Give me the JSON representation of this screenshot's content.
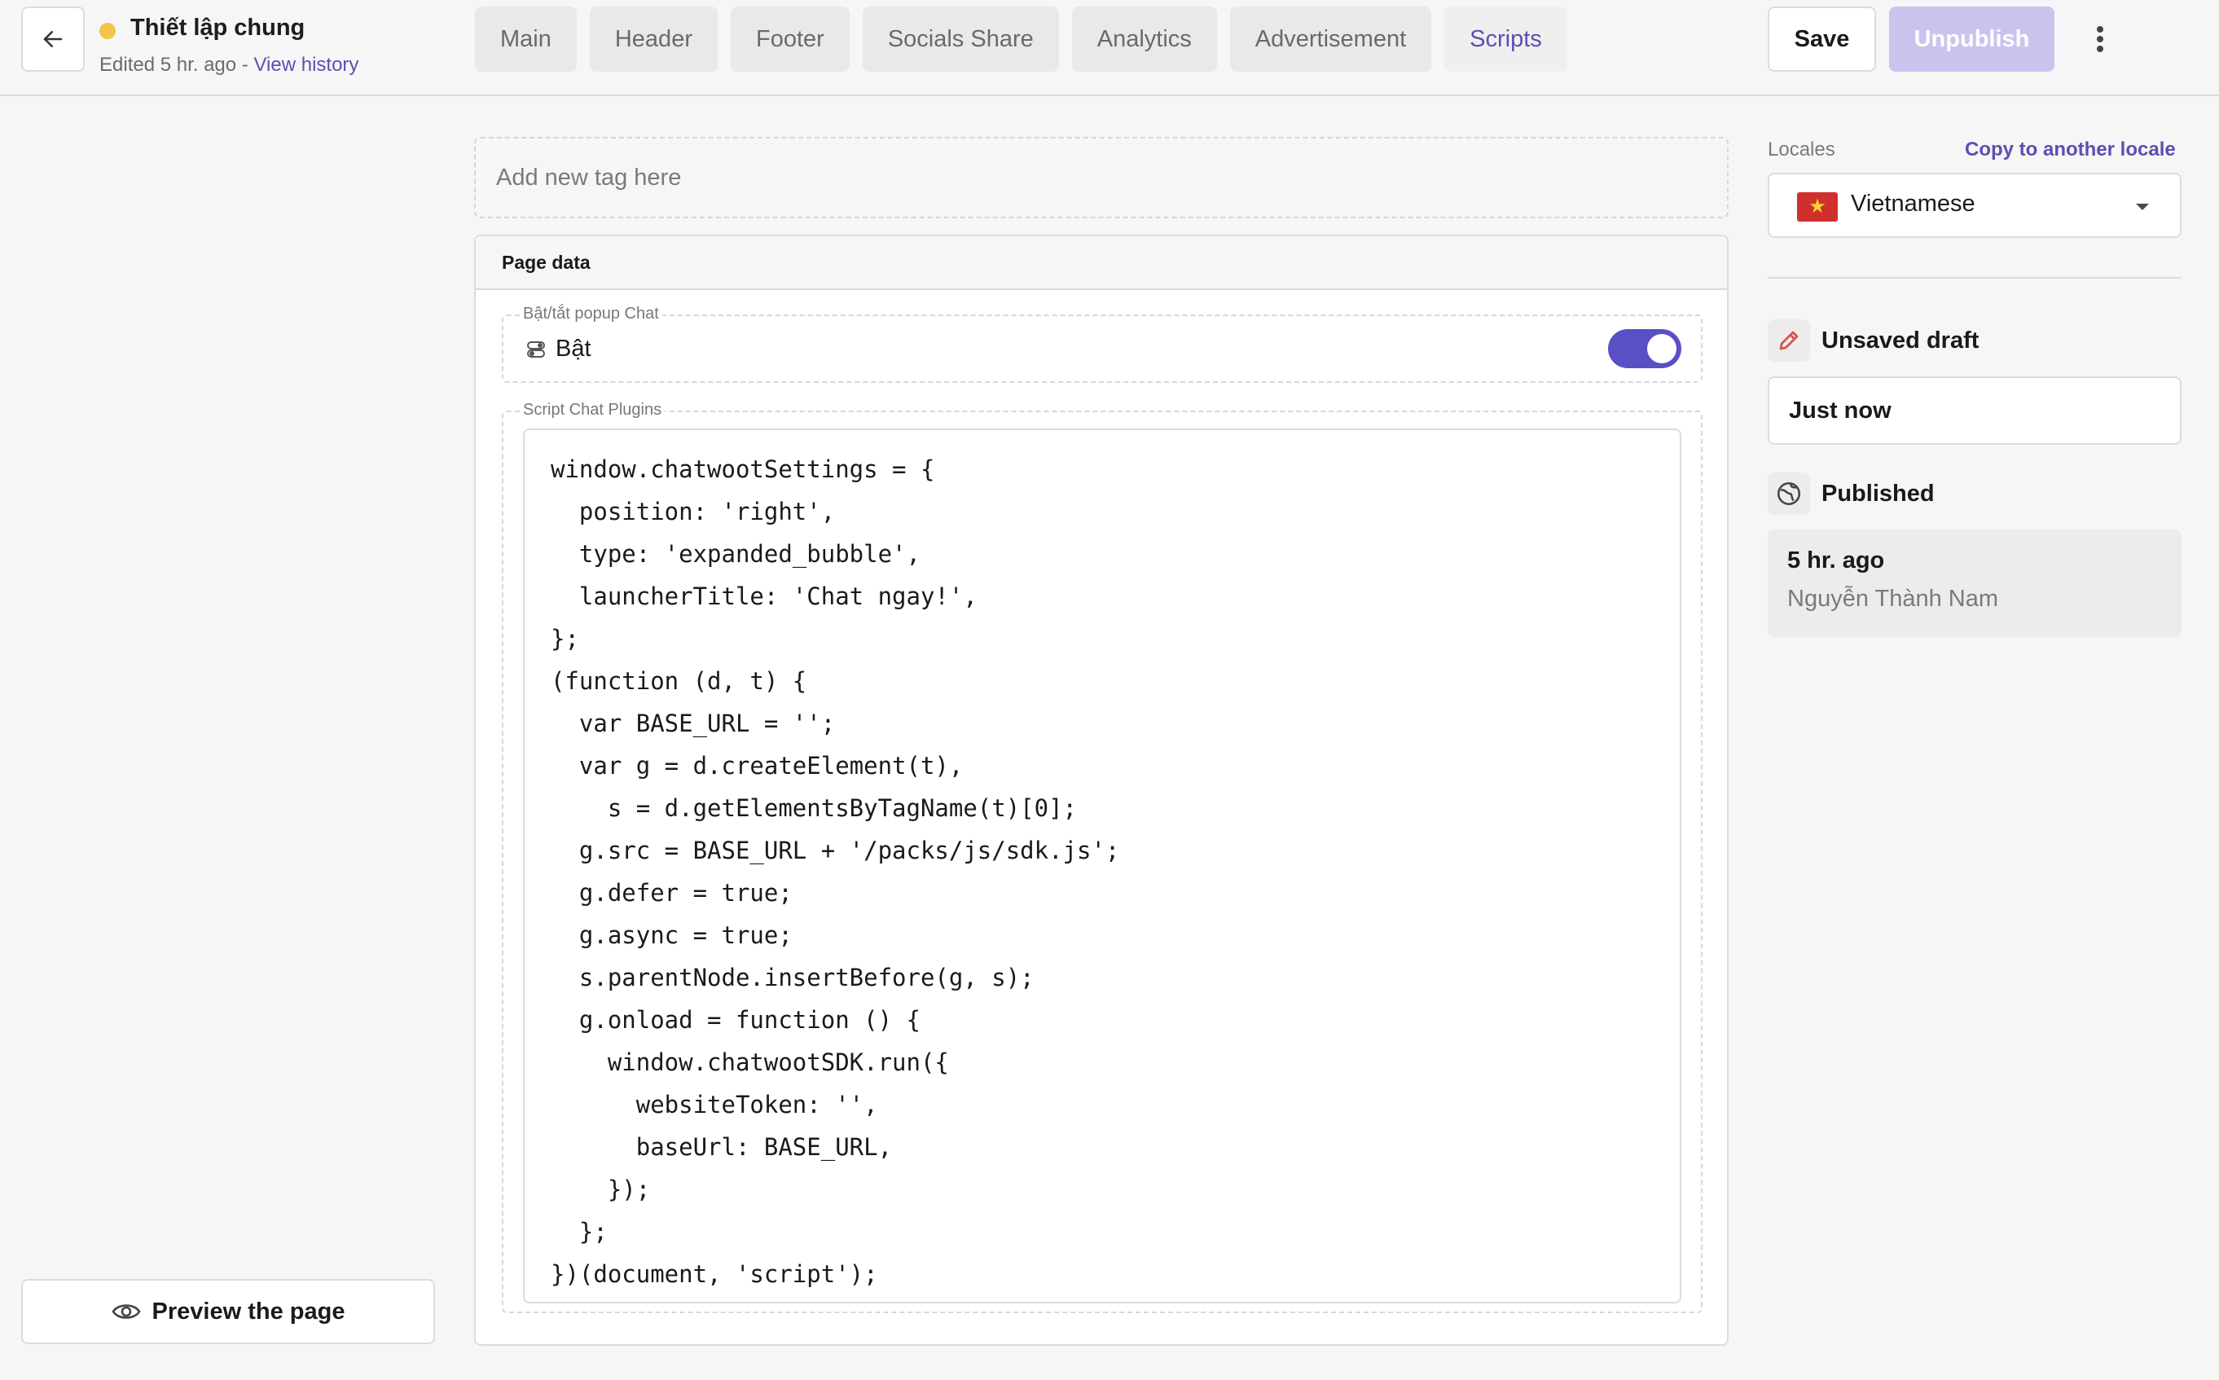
{
  "header": {
    "title": "Thiết lập chung",
    "edited_text": "Edited 5 hr. ago - ",
    "view_history": "View history",
    "tabs": [
      {
        "label": "Main"
      },
      {
        "label": "Header"
      },
      {
        "label": "Footer"
      },
      {
        "label": "Socials Share"
      },
      {
        "label": "Analytics"
      },
      {
        "label": "Advertisement"
      },
      {
        "label": "Scripts"
      }
    ],
    "active_tab": "Scripts",
    "save_label": "Save",
    "unpublish_label": "Unpublish"
  },
  "main": {
    "add_tag_placeholder": "Add new tag here",
    "page_data_title": "Page data",
    "toggle_field": {
      "legend": "Bật/tắt popup Chat",
      "value_label": "Bật",
      "checked": true
    },
    "script_field": {
      "legend": "Script Chat Plugins",
      "lines": [
        "window.chatwootSettings = {",
        "  position: 'right',",
        "  type: 'expanded_bubble',",
        "  launcherTitle: 'Chat ngay!',",
        "};",
        "(function (d, t) {",
        "  var BASE_URL = '';",
        "  var g = d.createElement(t),",
        "    s = d.getElementsByTagName(t)[0];",
        "  g.src = BASE_URL + '/packs/js/sdk.js';",
        "  g.defer = true;",
        "  g.async = true;",
        "  s.parentNode.insertBefore(g, s);",
        "  g.onload = function () {",
        "    window.chatwootSDK.run({",
        "      websiteToken: '',",
        "      baseUrl: BASE_URL,",
        "    });",
        "  };",
        "})(document, 'script');"
      ]
    }
  },
  "sidebar_left": {
    "preview_label": "Preview the page"
  },
  "sidebar_right": {
    "locales_label": "Locales",
    "copy_locale_label": "Copy to another locale",
    "selected_locale": "Vietnamese",
    "draft_title": "Unsaved draft",
    "draft_time": "Just now",
    "published_title": "Published",
    "published_time": "5 hr. ago",
    "published_by": "Nguyễn Thành Nam"
  },
  "icons": {
    "back": "arrow-left-icon",
    "more": "more-vertical-icon",
    "toggle": "toggle-icon",
    "preview": "eye-icon",
    "draft": "pencil-icon",
    "published": "globe-icon",
    "flag": "vietnam-flag-icon"
  },
  "colors": {
    "accent": "#5b4fc6",
    "accent_text": "#5b4fb3",
    "unpublish_disabled": "#c9c4ee",
    "status_dot": "#f3c44b",
    "draft_icon": "#d9534f"
  }
}
